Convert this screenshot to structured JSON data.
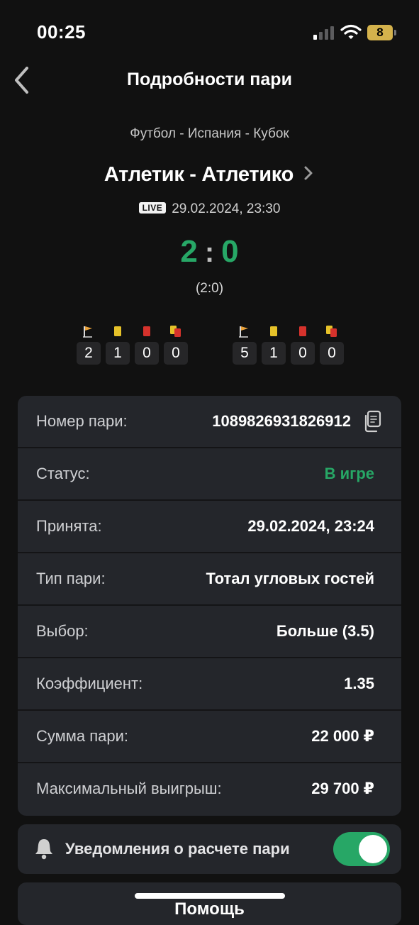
{
  "status_bar": {
    "time": "00:25",
    "battery_level": "8"
  },
  "nav": {
    "title": "Подробности пари"
  },
  "match": {
    "breadcrumb": "Футбол - Испания - Кубок",
    "teams": "Атлетик - Атлетико",
    "live_badge": "LIVE",
    "datetime": "29.02.2024, 23:30",
    "score_home": "2",
    "score_sep": ":",
    "score_away": "0",
    "halftime": "(2:0)",
    "home_stats": [
      {
        "icon": "corner-flag-icon",
        "value": "2"
      },
      {
        "icon": "yellow-card-icon",
        "value": "1"
      },
      {
        "icon": "red-card-icon",
        "value": "0"
      },
      {
        "icon": "second-yellow-card-icon",
        "value": "0"
      }
    ],
    "away_stats": [
      {
        "icon": "corner-flag-icon",
        "value": "5"
      },
      {
        "icon": "yellow-card-icon",
        "value": "1"
      },
      {
        "icon": "red-card-icon",
        "value": "0"
      },
      {
        "icon": "second-yellow-card-icon",
        "value": "0"
      }
    ]
  },
  "details": {
    "bet_number": {
      "label": "Номер пари:",
      "value": "1089826931826912"
    },
    "status": {
      "label": "Статус:",
      "value": "В игре"
    },
    "accepted": {
      "label": "Принята:",
      "value": "29.02.2024, 23:24"
    },
    "bet_type": {
      "label": "Тип пари:",
      "value": "Тотал угловых гостей"
    },
    "selection": {
      "label": "Выбор:",
      "value": "Больше (3.5)"
    },
    "odds": {
      "label": "Коэффициент:",
      "value": "1.35"
    },
    "stake": {
      "label": "Сумма пари:",
      "value": "22 000 ₽"
    },
    "max_win": {
      "label": "Максимальный выигрыш:",
      "value": "29 700 ₽"
    }
  },
  "notifications": {
    "label": "Уведомления о расчете пари",
    "enabled": true
  },
  "help": {
    "label": "Помощь"
  },
  "colors": {
    "accent_green": "#27a766",
    "background": "#111111",
    "card": "#24262b"
  }
}
